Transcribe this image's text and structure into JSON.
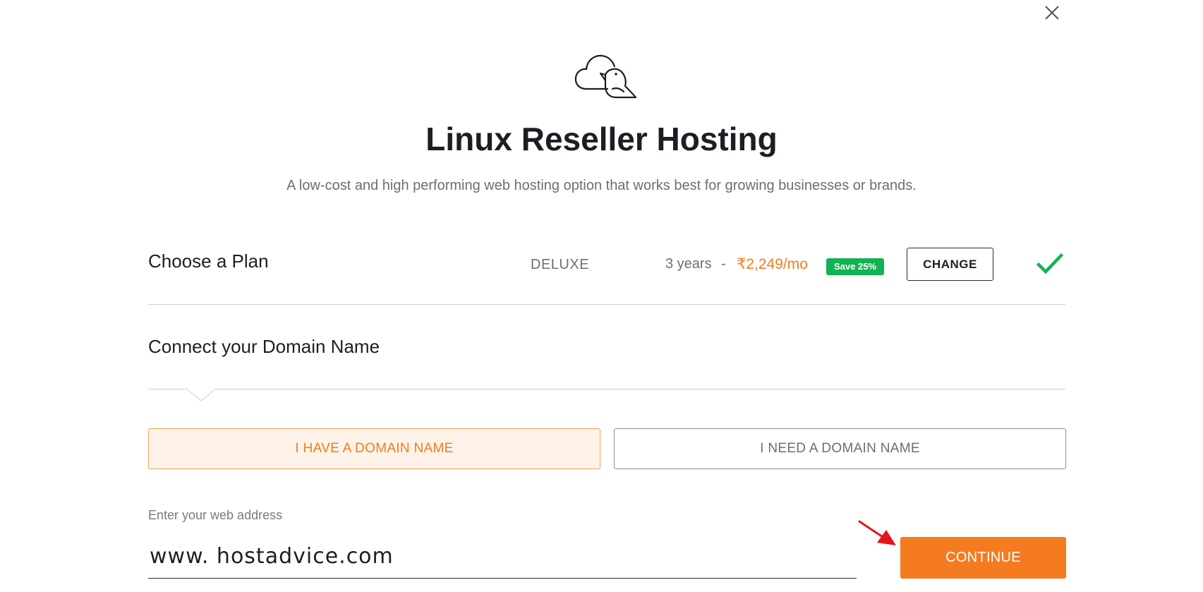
{
  "modal": {
    "close_icon": "close-icon",
    "logo_icon": "cloud-bird-logo"
  },
  "header": {
    "title": "Linux Reseller Hosting",
    "subtitle": "A low-cost and high performing web hosting option that works best for growing businesses or brands."
  },
  "plan": {
    "heading": "Choose a Plan",
    "name": "DELUXE",
    "term": "3 years",
    "separator": "-",
    "price": "₹2,249/mo",
    "save_badge": "Save 25%",
    "change_label": "CHANGE",
    "status_icon": "check-icon"
  },
  "domain": {
    "heading": "Connect your Domain Name",
    "options": [
      {
        "label": "I HAVE A DOMAIN NAME",
        "selected": true
      },
      {
        "label": "I NEED A DOMAIN NAME",
        "selected": false
      }
    ],
    "input_label": "Enter your web address",
    "input_value": "www. hostadvice.com",
    "continue_label": "CONTINUE"
  },
  "colors": {
    "accent": "#f47b20",
    "accent_light": "#fef3e8",
    "success": "#12b355",
    "annotation_arrow": "#e8141c"
  }
}
